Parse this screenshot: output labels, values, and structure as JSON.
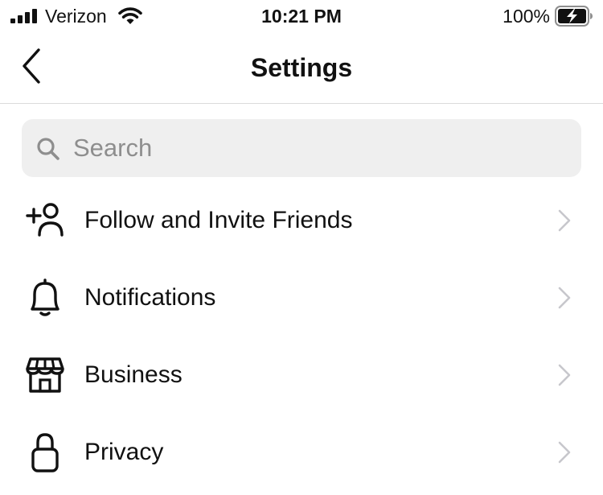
{
  "status_bar": {
    "carrier": "Verizon",
    "time": "10:21 PM",
    "battery_percent": "100%",
    "icons": [
      "signal-icon",
      "wifi-icon",
      "battery-charging-icon"
    ]
  },
  "nav": {
    "title": "Settings",
    "back_icon": "chevron-left-icon"
  },
  "search": {
    "placeholder": "Search",
    "value": "",
    "icon": "search-icon"
  },
  "menu": {
    "items": [
      {
        "label": "Follow and Invite Friends",
        "icon": "add-person-icon"
      },
      {
        "label": "Notifications",
        "icon": "bell-icon"
      },
      {
        "label": "Business",
        "icon": "shop-icon"
      },
      {
        "label": "Privacy",
        "icon": "lock-icon"
      }
    ],
    "chevron_icon": "chevron-right-icon"
  },
  "colors": {
    "text": "#111111",
    "divider": "#dbdbdb",
    "search_background": "#efefef",
    "placeholder": "#8e8e8e",
    "chevron": "#c7c7cc"
  }
}
